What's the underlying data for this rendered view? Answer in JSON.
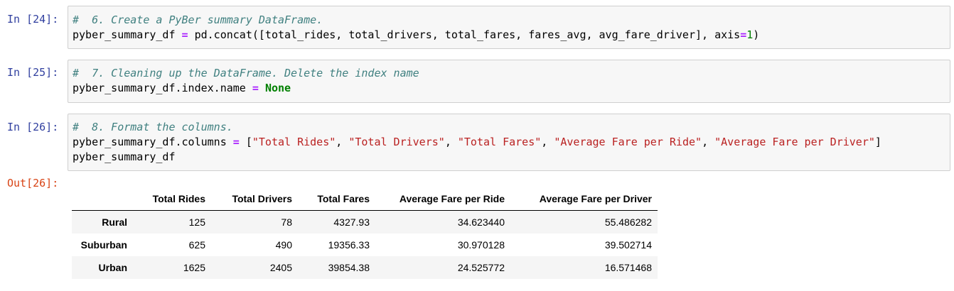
{
  "cells": [
    {
      "prompt": "In [24]:",
      "lines": [
        [
          {
            "t": "#  6. Create a PyBer summary DataFrame.",
            "c": "cm"
          }
        ],
        [
          {
            "t": "pyber_summary_df ",
            "c": ""
          },
          {
            "t": "=",
            "c": "op"
          },
          {
            "t": " pd.concat([total_rides, total_drivers, total_fares, fares_avg, avg_fare_driver], axis",
            "c": ""
          },
          {
            "t": "=",
            "c": "op"
          },
          {
            "t": "1",
            "c": "num"
          },
          {
            "t": ")",
            "c": ""
          }
        ]
      ]
    },
    {
      "prompt": "In [25]:",
      "lines": [
        [
          {
            "t": "#  7. Cleaning up the DataFrame. Delete the index name",
            "c": "cm"
          }
        ],
        [
          {
            "t": "pyber_summary_df.index.name ",
            "c": ""
          },
          {
            "t": "=",
            "c": "op"
          },
          {
            "t": " ",
            "c": ""
          },
          {
            "t": "None",
            "c": "kw"
          }
        ]
      ]
    },
    {
      "prompt": "In [26]:",
      "lines": [
        [
          {
            "t": "#  8. Format the columns.",
            "c": "cm"
          }
        ],
        [
          {
            "t": "pyber_summary_df.columns ",
            "c": ""
          },
          {
            "t": "=",
            "c": "op"
          },
          {
            "t": " [",
            "c": ""
          },
          {
            "t": "\"Total Rides\"",
            "c": "str"
          },
          {
            "t": ", ",
            "c": ""
          },
          {
            "t": "\"Total Drivers\"",
            "c": "str"
          },
          {
            "t": ", ",
            "c": ""
          },
          {
            "t": "\"Total Fares\"",
            "c": "str"
          },
          {
            "t": ", ",
            "c": ""
          },
          {
            "t": "\"Average Fare per Ride\"",
            "c": "str"
          },
          {
            "t": ", ",
            "c": ""
          },
          {
            "t": "\"Average Fare per Driver\"",
            "c": "str"
          },
          {
            "t": "]",
            "c": ""
          }
        ],
        [
          {
            "t": "pyber_summary_df",
            "c": ""
          }
        ]
      ]
    }
  ],
  "output": {
    "prompt": "Out[26]:",
    "columns": [
      "Total Rides",
      "Total Drivers",
      "Total Fares",
      "Average Fare per Ride",
      "Average Fare per Driver"
    ],
    "rows": [
      {
        "index": "Rural",
        "values": [
          "125",
          "78",
          "4327.93",
          "34.623440",
          "55.486282"
        ]
      },
      {
        "index": "Suburban",
        "values": [
          "625",
          "490",
          "19356.33",
          "30.970128",
          "39.502714"
        ]
      },
      {
        "index": "Urban",
        "values": [
          "1625",
          "2405",
          "39854.38",
          "24.525772",
          "16.571468"
        ]
      }
    ]
  }
}
